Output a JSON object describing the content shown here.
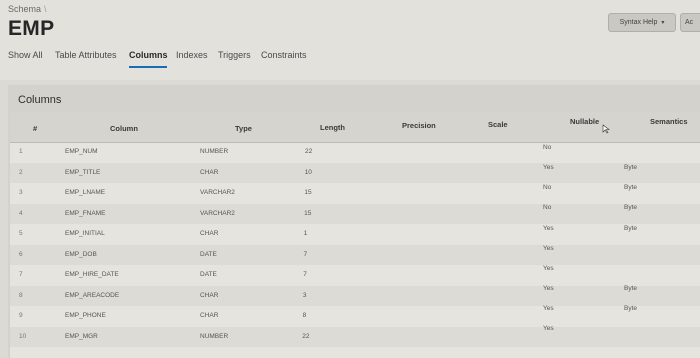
{
  "breadcrumb": "Schema",
  "page_title": "EMP",
  "toolbar": {
    "syntax_help": "Syntax Help",
    "ac": "Ac"
  },
  "tabs": [
    "Show All",
    "Table Attributes",
    "Columns",
    "Indexes",
    "Triggers",
    "Constraints"
  ],
  "active_tab": "Columns",
  "section_title": "Columns",
  "columns": [
    "#",
    "Column",
    "Type",
    "Length",
    "Precision",
    "Scale",
    "Nullable",
    "Semantics"
  ],
  "rows": [
    {
      "n": "1",
      "name": "EMP_NUM",
      "type": "NUMBER",
      "length": "22",
      "precision": "",
      "scale": "",
      "nullable": "No",
      "semantics": ""
    },
    {
      "n": "2",
      "name": "EMP_TITLE",
      "type": "CHAR",
      "length": "10",
      "precision": "",
      "scale": "",
      "nullable": "Yes",
      "semantics": "Byte"
    },
    {
      "n": "3",
      "name": "EMP_LNAME",
      "type": "VARCHAR2",
      "length": "15",
      "precision": "",
      "scale": "",
      "nullable": "No",
      "semantics": "Byte"
    },
    {
      "n": "4",
      "name": "EMP_FNAME",
      "type": "VARCHAR2",
      "length": "15",
      "precision": "",
      "scale": "",
      "nullable": "No",
      "semantics": "Byte"
    },
    {
      "n": "5",
      "name": "EMP_INITIAL",
      "type": "CHAR",
      "length": "1",
      "precision": "",
      "scale": "",
      "nullable": "Yes",
      "semantics": "Byte"
    },
    {
      "n": "6",
      "name": "EMP_DOB",
      "type": "DATE",
      "length": "7",
      "precision": "",
      "scale": "",
      "nullable": "Yes",
      "semantics": ""
    },
    {
      "n": "7",
      "name": "EMP_HIRE_DATE",
      "type": "DATE",
      "length": "7",
      "precision": "",
      "scale": "",
      "nullable": "Yes",
      "semantics": ""
    },
    {
      "n": "8",
      "name": "EMP_AREACODE",
      "type": "CHAR",
      "length": "3",
      "precision": "",
      "scale": "",
      "nullable": "Yes",
      "semantics": "Byte"
    },
    {
      "n": "9",
      "name": "EMP_PHONE",
      "type": "CHAR",
      "length": "8",
      "precision": "",
      "scale": "",
      "nullable": "Yes",
      "semantics": "Byte"
    },
    {
      "n": "10",
      "name": "EMP_MGR",
      "type": "NUMBER",
      "length": "22",
      "precision": "",
      "scale": "",
      "nullable": "Yes",
      "semantics": ""
    }
  ],
  "colors": {
    "accent": "#1a6db5",
    "background": "#dcdad4"
  },
  "icons": {
    "cursor": "mouse-pointer-icon",
    "dropdown": "chevron-down-icon"
  }
}
